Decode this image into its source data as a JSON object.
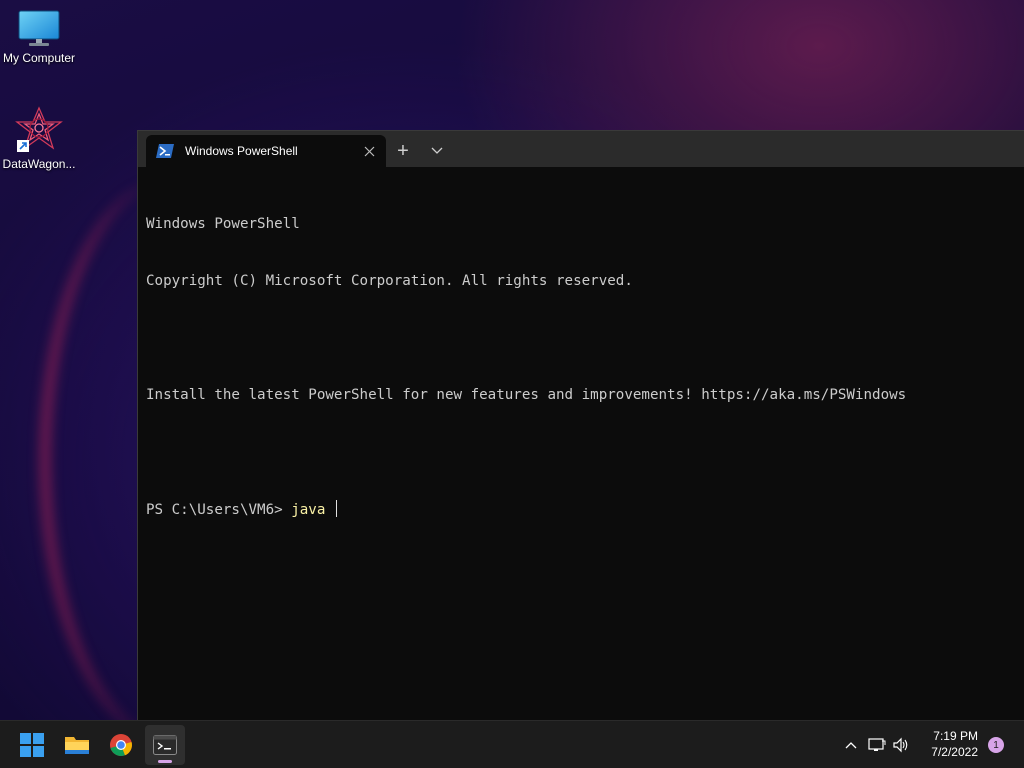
{
  "desktop": {
    "icons": [
      {
        "label": "My Computer",
        "icon": "monitor-icon"
      },
      {
        "label": "DataWagon...",
        "icon": "datawagon-shortcut-icon"
      }
    ]
  },
  "terminal": {
    "tab_title": "Windows PowerShell",
    "new_tab_symbol": "+",
    "dropdown_icon": "chevron-down-icon",
    "lines": [
      "Windows PowerShell",
      "Copyright (C) Microsoft Corporation. All rights reserved.",
      "",
      "Install the latest PowerShell for new features and improvements! https://aka.ms/PSWindows",
      ""
    ],
    "prompt": "PS C:\\Users\\VM6> ",
    "command": "java "
  },
  "taskbar": {
    "apps": [
      {
        "name": "start",
        "icon": "windows-logo-icon"
      },
      {
        "name": "file-explorer",
        "icon": "folder-icon"
      },
      {
        "name": "chrome",
        "icon": "chrome-icon"
      },
      {
        "name": "terminal",
        "icon": "terminal-icon",
        "active": true
      }
    ],
    "tray": {
      "time": "7:19 PM",
      "date": "7/2/2022",
      "notification_count": "1"
    }
  },
  "colors": {
    "terminal_bg": "#0c0c0c",
    "tabbar_bg": "#2b2b2b",
    "command_text": "#f9f1a5",
    "accent": "#d7a4e8"
  }
}
